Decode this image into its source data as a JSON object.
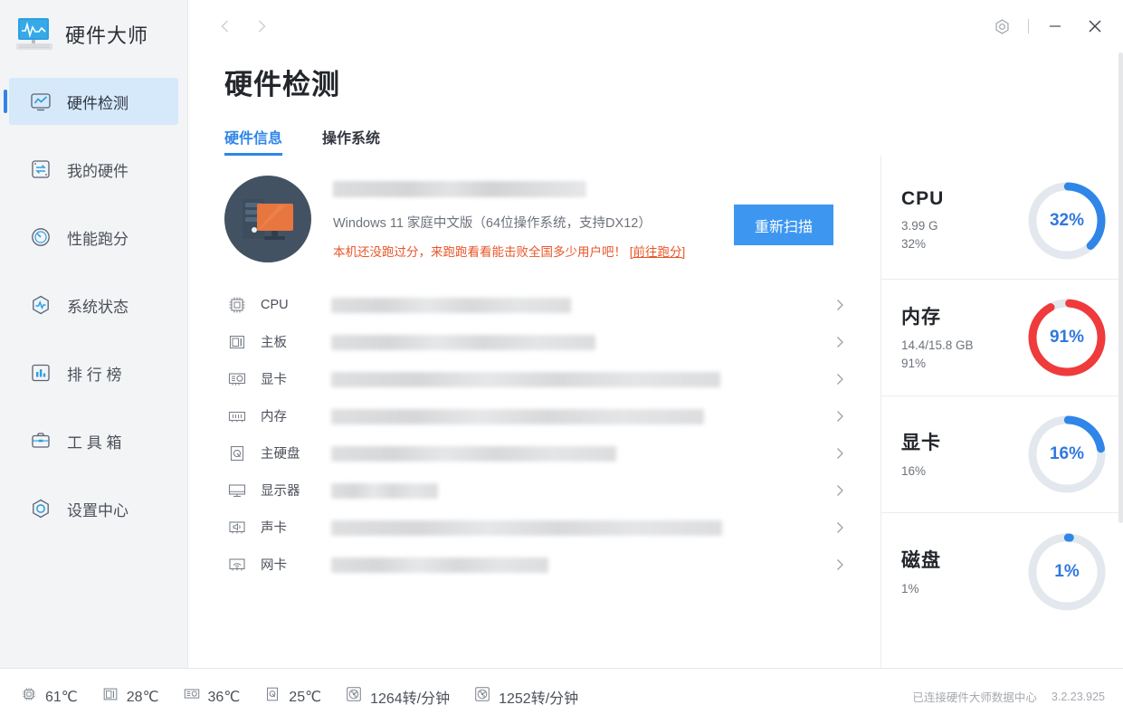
{
  "app": {
    "brand": "硬件大师",
    "logo_icon": "monitor-waveform-icon"
  },
  "sidebar": {
    "items": [
      {
        "label": "硬件检测",
        "icon": "chart-monitor-icon",
        "active": true
      },
      {
        "label": "我的硬件",
        "icon": "transfer-box-icon",
        "active": false
      },
      {
        "label": "性能跑分",
        "icon": "speedometer-icon",
        "active": false
      },
      {
        "label": "系统状态",
        "icon": "hexagon-pulse-icon",
        "active": false
      },
      {
        "label": "排 行 榜",
        "icon": "bar-chart-icon",
        "active": false
      },
      {
        "label": "工 具 箱",
        "icon": "toolbox-icon",
        "active": false
      },
      {
        "label": "设置中心",
        "icon": "hexagon-gear-icon",
        "active": false
      }
    ]
  },
  "titlebar": {
    "back_icon": "chevron-left-icon",
    "forward_icon": "chevron-right-icon",
    "settings_icon": "hexagon-gear-icon",
    "minimize_icon": "minimize-icon",
    "close_icon": "close-icon"
  },
  "page": {
    "title": "硬件检测",
    "tabs": [
      {
        "label": "硬件信息",
        "active": true
      },
      {
        "label": "操作系统",
        "active": false
      }
    ]
  },
  "summary": {
    "avatar_icon": "desktop-computer-illustration",
    "machine_name_redacted": true,
    "os_line": "Windows 11 家庭中文版（64位操作系统，支持DX12）",
    "promo_text": "本机还没跑过分，来跑跑看看能击败全国多少用户吧！",
    "promo_link": "[前往跑分]",
    "scan_button": "重新扫描",
    "scan_button_color": "#3d97f1",
    "promo_color": "#e8562a"
  },
  "hardware_list": [
    {
      "name": "CPU",
      "icon": "cpu-chip-icon",
      "value_redacted": true,
      "chevron": "chevron-right-icon"
    },
    {
      "name": "主板",
      "icon": "motherboard-icon",
      "value_redacted": true,
      "chevron": "chevron-right-icon"
    },
    {
      "name": "显卡",
      "icon": "graphics-card-icon",
      "value_redacted": true,
      "chevron": "chevron-right-icon"
    },
    {
      "name": "内存",
      "icon": "memory-ram-icon",
      "value_redacted": true,
      "chevron": "chevron-right-icon"
    },
    {
      "name": "主硬盘",
      "icon": "hard-disk-icon",
      "value_redacted": true,
      "chevron": "chevron-right-icon"
    },
    {
      "name": "显示器",
      "icon": "display-icon",
      "value_redacted": true,
      "chevron": "chevron-right-icon"
    },
    {
      "name": "声卡",
      "icon": "sound-card-icon",
      "value_redacted": true,
      "chevron": "chevron-right-icon"
    },
    {
      "name": "网卡",
      "icon": "network-card-icon",
      "value_redacted": true,
      "chevron": "chevron-right-icon"
    }
  ],
  "gauges": [
    {
      "title": "CPU",
      "lines": "3.99 G\n32%",
      "percent": 32,
      "percent_label": "32%",
      "color": "#2f86e8"
    },
    {
      "title": "内存",
      "lines": "14.4/15.8 GB\n91%",
      "percent": 91,
      "percent_label": "91%",
      "color": "#ef3b3b"
    },
    {
      "title": "显卡",
      "lines": "16%",
      "percent": 16,
      "percent_label": "16%",
      "color": "#2f86e8"
    },
    {
      "title": "磁盘",
      "lines": "1%",
      "percent": 1,
      "percent_label": "1%",
      "color": "#2f86e8"
    }
  ],
  "statusbar": {
    "items": [
      {
        "icon": "cpu-temp-icon",
        "value": "61℃"
      },
      {
        "icon": "motherboard-temp-icon",
        "value": "28℃"
      },
      {
        "icon": "gpu-temp-icon",
        "value": "36℃"
      },
      {
        "icon": "disk-temp-icon",
        "value": "25℃"
      },
      {
        "icon": "fan-speed-icon",
        "value": "1264转/分钟"
      },
      {
        "icon": "fan-speed-icon",
        "value": "1252转/分钟"
      }
    ],
    "connection": "已连接硬件大师数据中心",
    "version": "3.2.23.925"
  }
}
